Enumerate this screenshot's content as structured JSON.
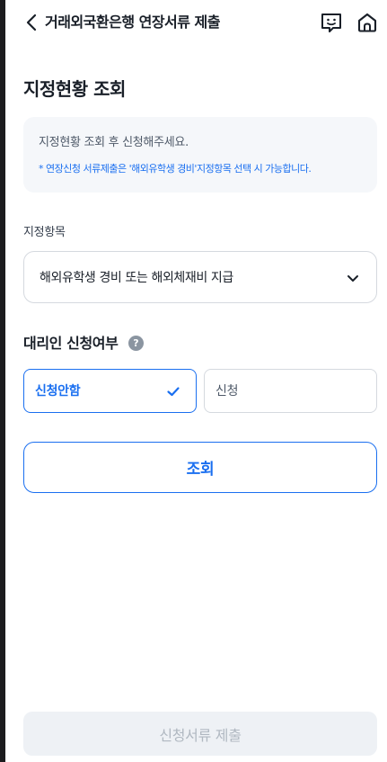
{
  "header": {
    "title": "거래외국환은행 연장서류 제출",
    "back_icon": "chevron-left-icon",
    "chat_icon": "chatbot-icon",
    "home_icon": "home-icon"
  },
  "main": {
    "section_title": "지정현황 조회",
    "notice": {
      "main": "지정현황 조회 후 신청해주세요.",
      "sub": "* 연장신청 서류제출은 '해외유학생 경비'지정항목 선택 시 가능합니다."
    },
    "designation": {
      "label": "지정항목",
      "selected": "해외유학생 경비 또는 해외체재비 지급"
    },
    "proxy": {
      "title": "대리인 신청여부",
      "help": "?",
      "options": [
        {
          "label": "신청안함",
          "selected": true
        },
        {
          "label": "신청",
          "selected": false
        }
      ]
    },
    "query_button": "조회",
    "submit_button": "신청서류 제출"
  },
  "colors": {
    "accent": "#1a6ff0",
    "text": "#191f28",
    "border": "#d5d9df",
    "notice_bg": "#f5f7fa",
    "disabled_bg": "#eef1f5",
    "disabled_text": "#b0b8c1"
  }
}
